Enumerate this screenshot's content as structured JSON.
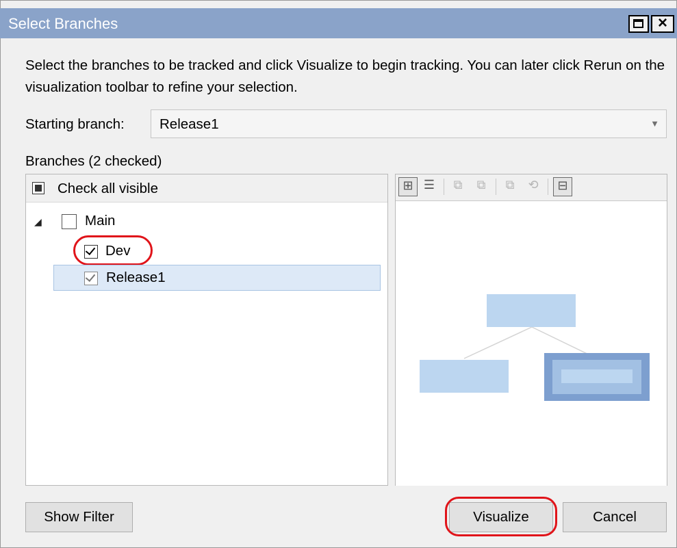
{
  "window": {
    "title": "Select Branches",
    "maximize_icon": "maximize-icon",
    "close_icon": "close-icon"
  },
  "instructions": "Select the branches to be tracked and click Visualize to begin tracking. You can later click Rerun on the visualization toolbar to refine your selection.",
  "starting_branch": {
    "label": "Starting branch:",
    "value": "Release1"
  },
  "branches": {
    "label": "Branches (2 checked)",
    "check_all_label": "Check all visible",
    "items": [
      {
        "label": "Main",
        "checked": false,
        "level": 0,
        "expanded": true
      },
      {
        "label": "Dev",
        "checked": true,
        "level": 1
      },
      {
        "label": "Release1",
        "checked": true,
        "level": 1,
        "selected": true,
        "disabled": true
      }
    ]
  },
  "viz_toolbar": {
    "tools": [
      "tree-view-icon",
      "checklist-icon",
      "expand-icon",
      "collapse-icon",
      "zoom-icon",
      "rerun-icon",
      "layout-icon"
    ]
  },
  "buttons": {
    "show_filter": "Show Filter",
    "visualize": "Visualize",
    "cancel": "Cancel"
  },
  "colors": {
    "titlebar": "#8aa3c9",
    "annotation": "#e0141a",
    "node_fill": "#bcd6f0",
    "node_selected": "#7d9fcf"
  }
}
